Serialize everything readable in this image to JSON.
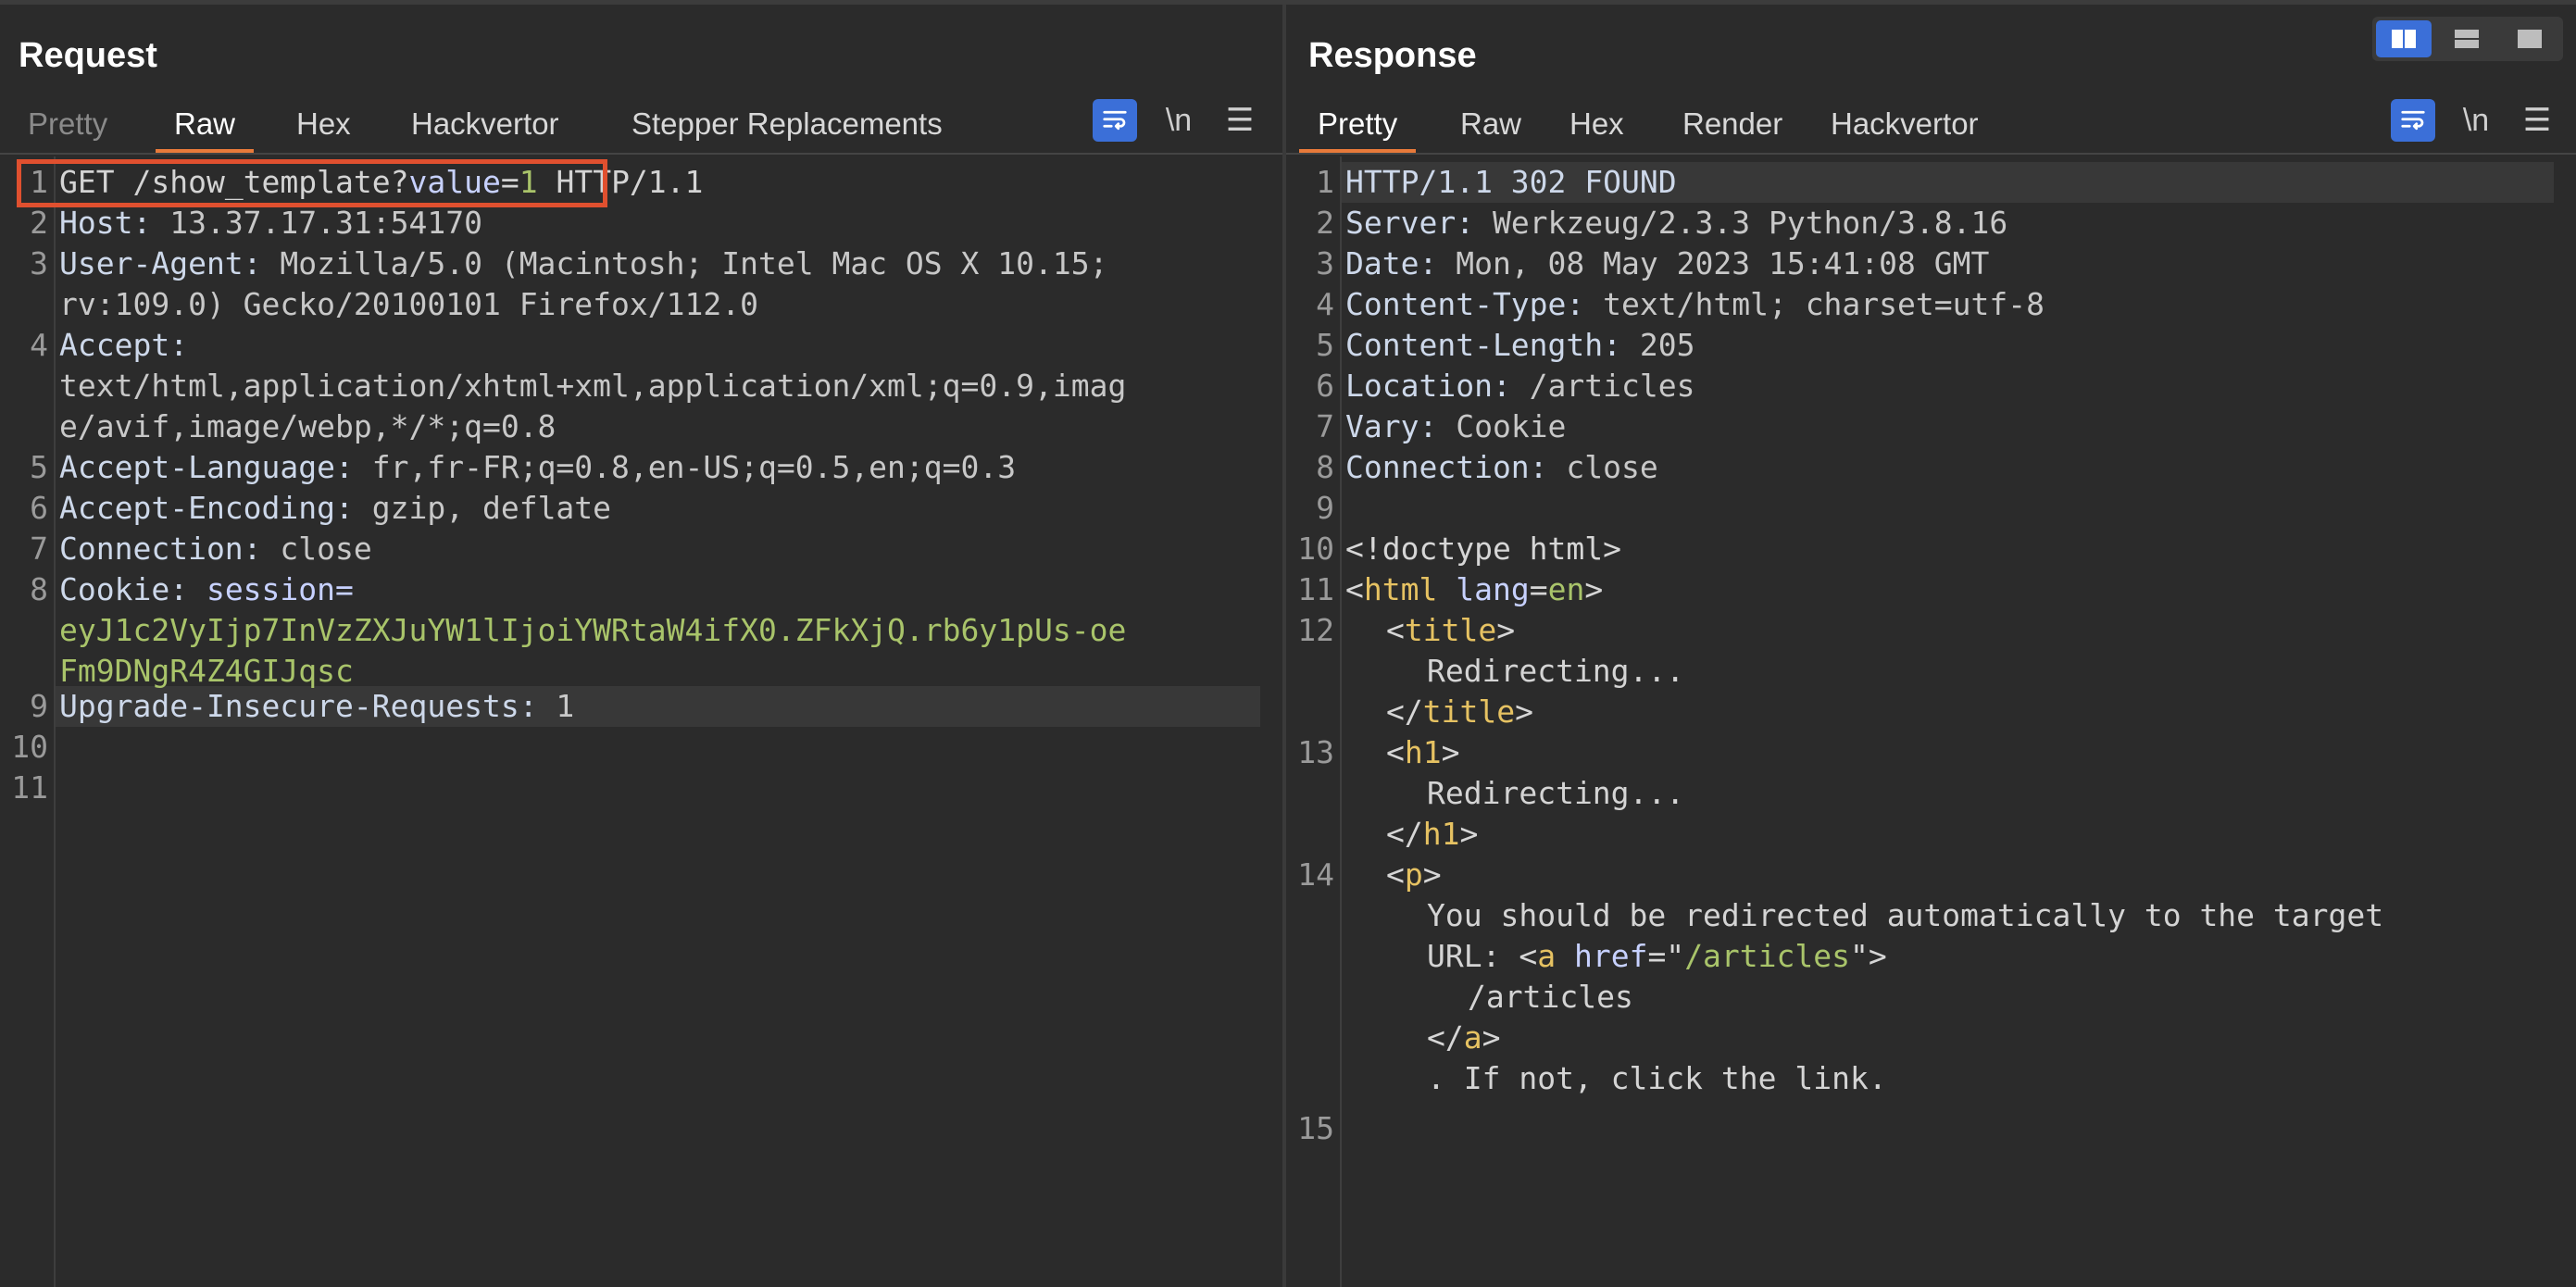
{
  "request": {
    "title": "Request",
    "tabs": [
      "Pretty",
      "Raw",
      "Hex",
      "Hackvertor",
      "Stepper Replacements"
    ],
    "active_tab": "Raw",
    "newline_label": "\\n",
    "line_numbers": [
      "1",
      "2",
      "3",
      "",
      "4",
      "",
      "",
      "5",
      "6",
      "7",
      "8",
      "",
      "",
      "9",
      "10",
      "11"
    ],
    "lines": {
      "l1_method": "GET ",
      "l1_path": "/show_template?",
      "l1_param": "value",
      "l1_eq": "=",
      "l1_val": "1",
      "l1_proto": " HTTP/1.1",
      "l2_name": "Host:",
      "l2_val": " 13.37.17.31:54170",
      "l3_name": "User-Agent:",
      "l3_val": " Mozilla/5.0 (Macintosh; Intel Mac OS X 10.15;",
      "l3b_val": "rv:109.0) Gecko/20100101 Firefox/112.0",
      "l4_name": "Accept:",
      "l4b_val": "text/html,application/xhtml+xml,application/xml;q=0.9,imag",
      "l4c_val": "e/avif,image/webp,*/*;q=0.8",
      "l5_name": "Accept-Language:",
      "l5_val": " fr,fr-FR;q=0.8,en-US;q=0.5,en;q=0.3",
      "l6_name": "Accept-Encoding:",
      "l6_val": " gzip, deflate",
      "l7_name": "Connection:",
      "l7_val": " close",
      "l8_name": "Cookie:",
      "l8_key": " session=",
      "l8b_val": "eyJ1c2VyIjp7InVzZXJuYW1lIjoiYWRtaW4ifX0.ZFkXjQ.rb6y1pUs-oe",
      "l8c_val": "Fm9DNgR4Z4GIJqsc",
      "l9_name": "Upgrade-Insecure-Requests:",
      "l9_val": " 1"
    }
  },
  "response": {
    "title": "Response",
    "tabs": [
      "Pretty",
      "Raw",
      "Hex",
      "Render",
      "Hackvertor"
    ],
    "active_tab": "Pretty",
    "newline_label": "\\n",
    "line_numbers": [
      "1",
      "2",
      "3",
      "4",
      "5",
      "6",
      "7",
      "8",
      "9",
      "10",
      "11",
      "12",
      "",
      "",
      "13",
      "",
      "",
      "14",
      "",
      "",
      "",
      "",
      "",
      "15"
    ],
    "lines": {
      "r1": "HTTP/1.1 302 FOUND",
      "r2_name": "Server:",
      "r2_val": " Werkzeug/2.3.3 Python/3.8.16",
      "r3_name": "Date:",
      "r3_val": " Mon, 08 May 2023 15:41:08 GMT",
      "r4_name": "Content-Type:",
      "r4_val": " text/html; charset=utf-8",
      "r5_name": "Content-Length:",
      "r5_val": " 205",
      "r6_name": "Location:",
      "r6_val": " /articles",
      "r7_name": "Vary:",
      "r7_val": " Cookie",
      "r8_name": "Connection:",
      "r8_val": " close",
      "r10": "<!doctype html>",
      "r11_open": "<",
      "r11_tag": "html",
      "r11_attr": " lang",
      "r11_eq": "=",
      "r11_val": "en",
      "r11_close": ">",
      "lt": "<",
      "gt": ">",
      "lt_slash": "</",
      "title_tag": "title",
      "h1_tag": "h1",
      "p_tag": "p",
      "a_tag": "a",
      "redirecting": "Redirecting...",
      "p_text": "You should be redirected automatically to the target",
      "url_label": "URL: ",
      "href_attr": " href",
      "eq_quote": "=\"",
      "href_val": "/articles",
      "quote": "\"",
      "a_text": "/articles",
      "tail_text": ". If not, click the link."
    }
  }
}
